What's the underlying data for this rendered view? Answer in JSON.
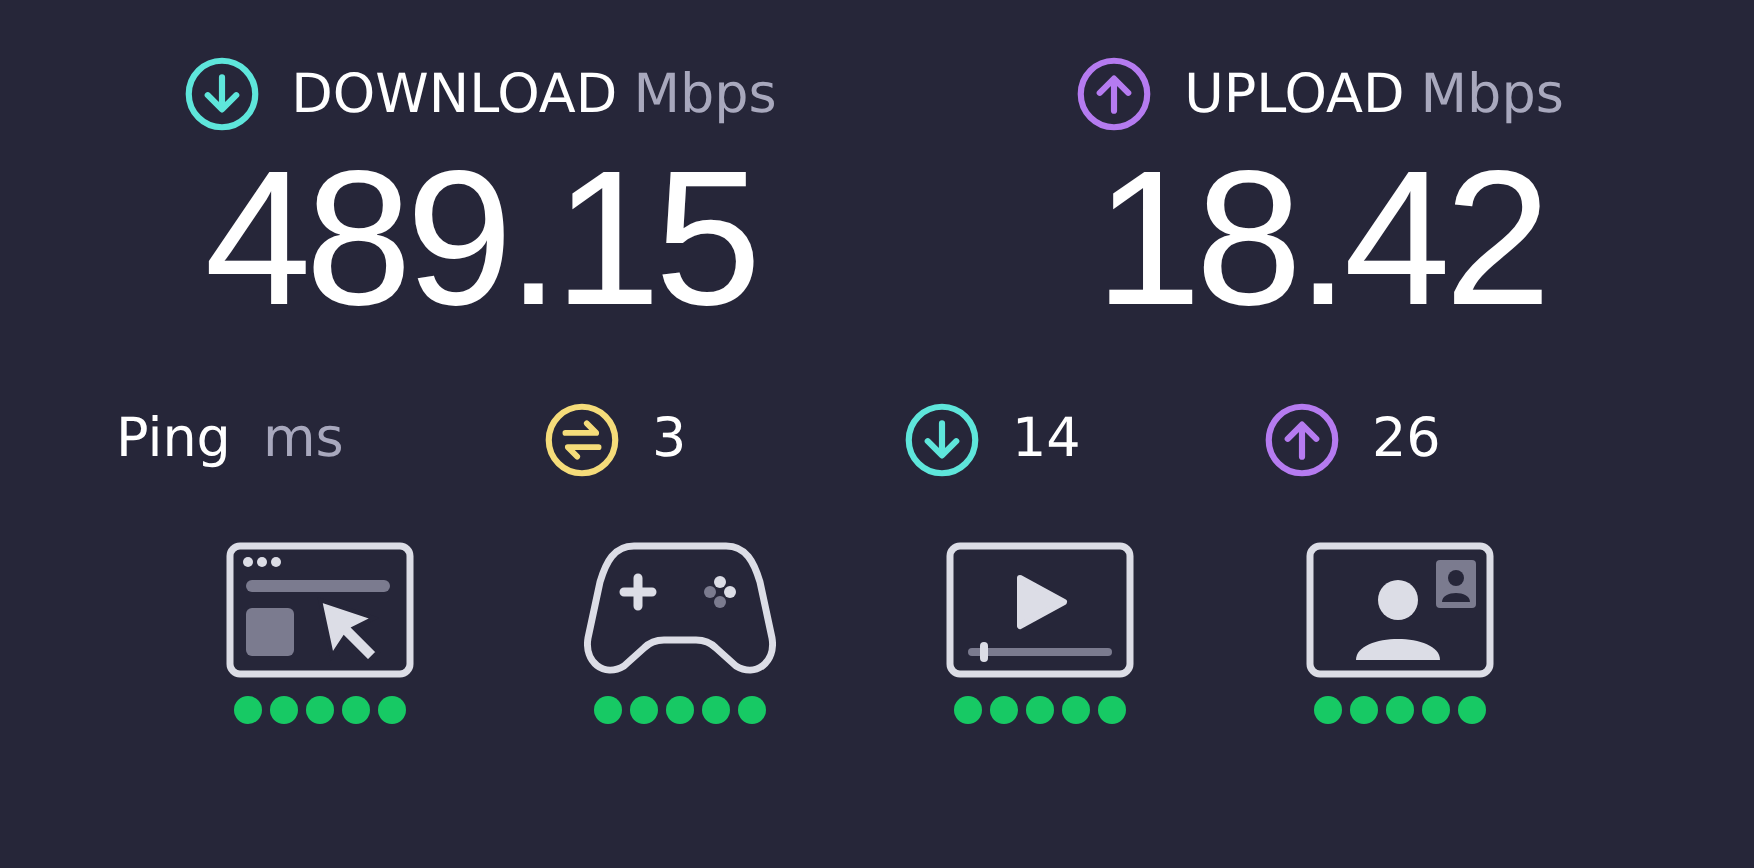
{
  "download": {
    "label": "DOWNLOAD",
    "unit": "Mbps",
    "value": "489.15"
  },
  "upload": {
    "label": "UPLOAD",
    "unit": "Mbps",
    "value": "18.42"
  },
  "ping": {
    "label": "Ping",
    "unit": "ms",
    "stats": [
      {
        "kind": "idle",
        "value": "3"
      },
      {
        "kind": "download",
        "value": "14"
      },
      {
        "kind": "upload",
        "value": "26"
      }
    ]
  },
  "ratings": [
    {
      "kind": "browsing",
      "stars": 5
    },
    {
      "kind": "gaming",
      "stars": 5
    },
    {
      "kind": "streaming",
      "stars": 5
    },
    {
      "kind": "video_call",
      "stars": 5
    }
  ]
}
